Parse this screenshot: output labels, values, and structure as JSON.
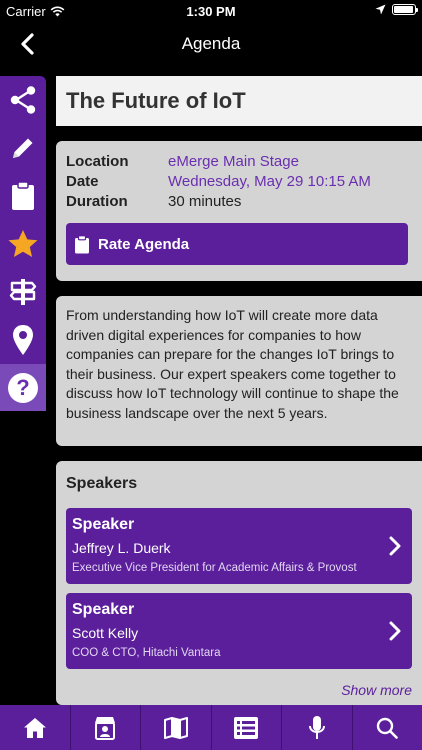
{
  "status_bar": {
    "carrier": "Carrier",
    "time": "1:30 PM",
    "battery_level": 0.95
  },
  "nav": {
    "title": "Agenda",
    "back_icon": "chevron-left-icon"
  },
  "sidebar": {
    "items": [
      {
        "icon": "share-icon"
      },
      {
        "icon": "pencil-icon"
      },
      {
        "icon": "clipboard-icon"
      },
      {
        "icon": "star-icon",
        "color": "#f5a623"
      },
      {
        "icon": "signpost-icon"
      },
      {
        "icon": "map-pin-icon"
      },
      {
        "icon": "help-icon",
        "label": "?",
        "active": true
      }
    ]
  },
  "session": {
    "title": "The Future of IoT",
    "details": [
      {
        "label": "Location",
        "value": "eMerge Main Stage"
      },
      {
        "label": "Date",
        "value": "Wednesday, May 29 10:15 AM"
      },
      {
        "label": "Duration",
        "value": "30 minutes"
      }
    ],
    "rate_label": "Rate Agenda",
    "description": "From understanding how IoT will create more data driven digital experiences for companies to how companies can prepare for the changes IoT brings to their business. Our expert speakers come together to discuss how IoT technology will continue to shape the business landscape over the next 5 years."
  },
  "speakers": {
    "heading": "Speakers",
    "items": [
      {
        "role": "Speaker",
        "name": "Jeffrey L. Duerk",
        "detail": "Executive Vice President for Academic Affairs & Provost"
      },
      {
        "role": "Speaker",
        "name": "Scott Kelly",
        "detail": "COO & CTO, Hitachi Vantara"
      }
    ],
    "show_more": "Show more"
  },
  "tabbar": {
    "items": [
      {
        "icon": "home-icon"
      },
      {
        "icon": "badge-icon"
      },
      {
        "icon": "map-icon"
      },
      {
        "icon": "list-icon",
        "active": true
      },
      {
        "icon": "microphone-icon"
      },
      {
        "icon": "search-icon"
      }
    ]
  },
  "colors": {
    "brand": "#5b1f9c",
    "link": "#6a2fb0",
    "star": "#f5a623"
  }
}
